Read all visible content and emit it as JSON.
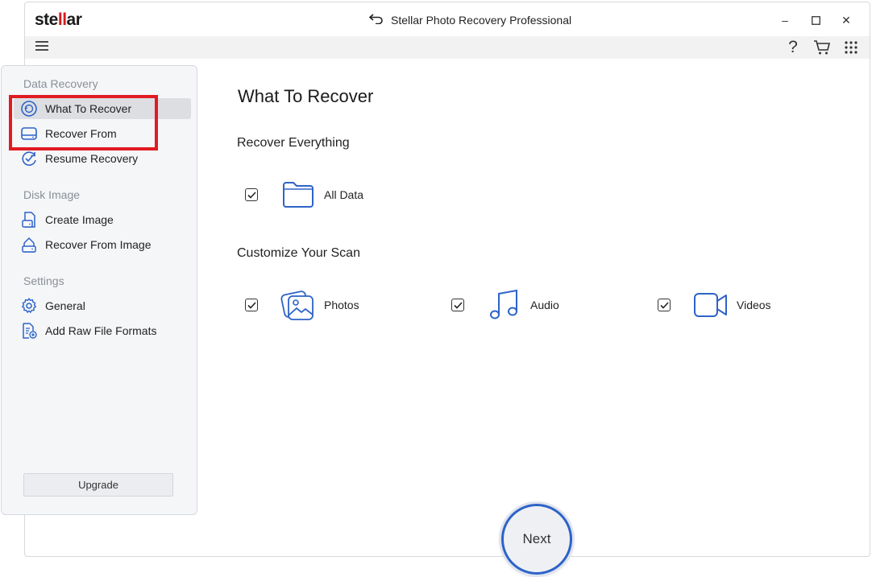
{
  "app": {
    "logo_prefix": "ste",
    "logo_mid": "ll",
    "logo_suffix": "ar",
    "title": "Stellar Photo Recovery Professional"
  },
  "window_controls": {
    "minimize": "–",
    "maximize": "☐",
    "close": "✕"
  },
  "toolbar": {
    "help": "?"
  },
  "sidebar": {
    "sections": [
      {
        "label": "Data Recovery",
        "items": [
          {
            "label": "What To Recover",
            "icon": "recover-target-icon"
          },
          {
            "label": "Recover From",
            "icon": "drive-icon"
          },
          {
            "label": "Resume Recovery",
            "icon": "resume-icon"
          }
        ]
      },
      {
        "label": "Disk Image",
        "items": [
          {
            "label": "Create Image",
            "icon": "create-image-icon"
          },
          {
            "label": "Recover From Image",
            "icon": "image-recover-icon"
          }
        ]
      },
      {
        "label": "Settings",
        "items": [
          {
            "label": "General",
            "icon": "gear-icon"
          },
          {
            "label": "Add Raw File Formats",
            "icon": "file-add-icon"
          }
        ]
      }
    ],
    "upgrade_label": "Upgrade"
  },
  "main": {
    "title": "What To Recover",
    "recover_everything": {
      "heading": "Recover Everything",
      "option": {
        "label": "All Data",
        "checked": true,
        "icon": "folder-icon"
      }
    },
    "customize": {
      "heading": "Customize Your Scan",
      "options": [
        {
          "label": "Photos",
          "checked": true,
          "icon": "photos-icon"
        },
        {
          "label": "Audio",
          "checked": true,
          "icon": "music-note-icon"
        },
        {
          "label": "Videos",
          "checked": true,
          "icon": "video-camera-icon"
        }
      ]
    },
    "next_label": "Next"
  },
  "colors": {
    "accent": "#2d63c8",
    "highlight": "#e11b22",
    "brand_red": "#d7191f"
  }
}
